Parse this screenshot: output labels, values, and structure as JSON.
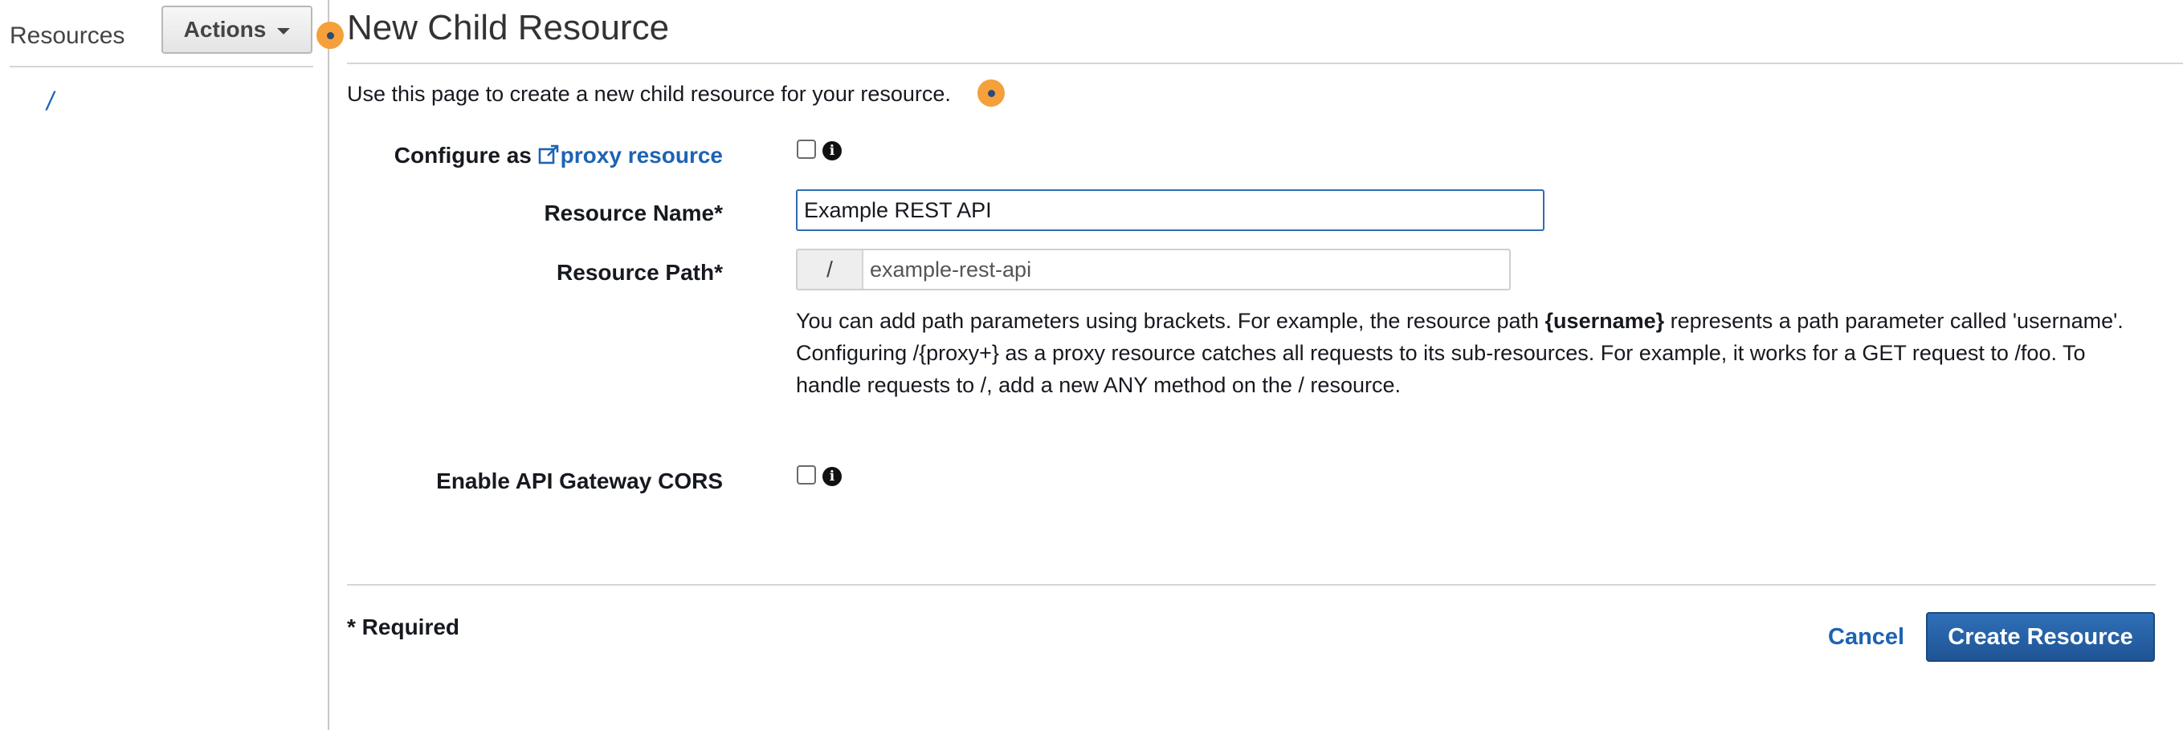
{
  "sidebar": {
    "title": "Resources",
    "actions_label": "Actions",
    "tree": [
      {
        "label": "/"
      }
    ]
  },
  "main": {
    "title": "New Child Resource",
    "intro": "Use this page to create a new child resource for your resource.",
    "proxy": {
      "label_prefix": "Configure as ",
      "link_text": "proxy resource",
      "checked": false
    },
    "resource_name": {
      "label": "Resource Name*",
      "value": "Example REST API"
    },
    "resource_path": {
      "label": "Resource Path*",
      "prefix": "/",
      "value": "example-rest-api"
    },
    "help": {
      "part1": "You can add path parameters using brackets. For example, the resource path ",
      "param": "{username}",
      "part2": " represents a path parameter called 'username'. Configuring /{proxy+} as a proxy resource catches all requests to its sub-resources. For example, it works for a GET request to /foo. To handle requests to /, add a new ANY method on the / resource."
    },
    "cors": {
      "label": "Enable API Gateway CORS",
      "checked": false
    },
    "required_note": "* Required",
    "cancel_label": "Cancel",
    "create_label": "Create Resource"
  },
  "icons": {
    "info": "info-icon",
    "external": "external-link-icon",
    "help": "help-dot-icon",
    "caret": "caret-down-icon"
  },
  "colors": {
    "link": "#1d63b3",
    "primary_button": "#2a65aa",
    "help_dot": "#f5a03a",
    "input_focus_border": "#2e6db3"
  }
}
